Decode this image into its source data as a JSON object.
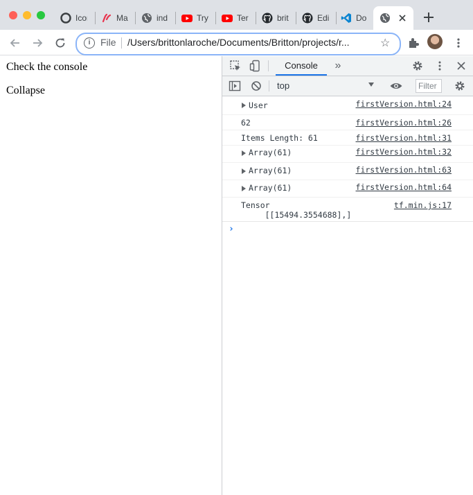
{
  "browser": {
    "tabs": [
      {
        "title": "Icon",
        "icon": "wrench-circle-icon"
      },
      {
        "title": "Ma",
        "icon": "brush-icon"
      },
      {
        "title": "ind",
        "icon": "globe-icon"
      },
      {
        "title": "Try",
        "icon": "youtube-icon"
      },
      {
        "title": "Ter",
        "icon": "youtube-icon"
      },
      {
        "title": "brit",
        "icon": "github-icon"
      },
      {
        "title": "Edi",
        "icon": "github-icon"
      },
      {
        "title": "Do",
        "icon": "vscode-icon"
      },
      {
        "title": "",
        "icon": "globe-icon",
        "active": true
      }
    ],
    "omnibox": {
      "scheme": "File",
      "url": "/Users/brittonlaroche/Documents/Britton/projects/r..."
    }
  },
  "page": {
    "lines": [
      "Check the console",
      "Collapse"
    ]
  },
  "devtools": {
    "active_tab": "Console",
    "context": "top",
    "filter_placeholder": "Filter",
    "console_rows": [
      {
        "text": "User",
        "expandable": true,
        "source": "firstVersion.html:24"
      },
      {
        "text": "62",
        "expandable": false,
        "source": "firstVersion.html:26"
      },
      {
        "text": "Items Length: 61",
        "expandable": false,
        "source": "firstVersion.html:31"
      },
      {
        "text": "Array(61)",
        "expandable": true,
        "source": "firstVersion.html:32"
      },
      {
        "text": "Array(61)",
        "expandable": true,
        "source": "firstVersion.html:63"
      },
      {
        "text": "Array(61)",
        "expandable": true,
        "source": "firstVersion.html:64"
      },
      {
        "text": "Tensor\n     [[15494.3554688],]",
        "expandable": false,
        "source": "tf.min.js:17"
      }
    ],
    "prompt": "›"
  }
}
